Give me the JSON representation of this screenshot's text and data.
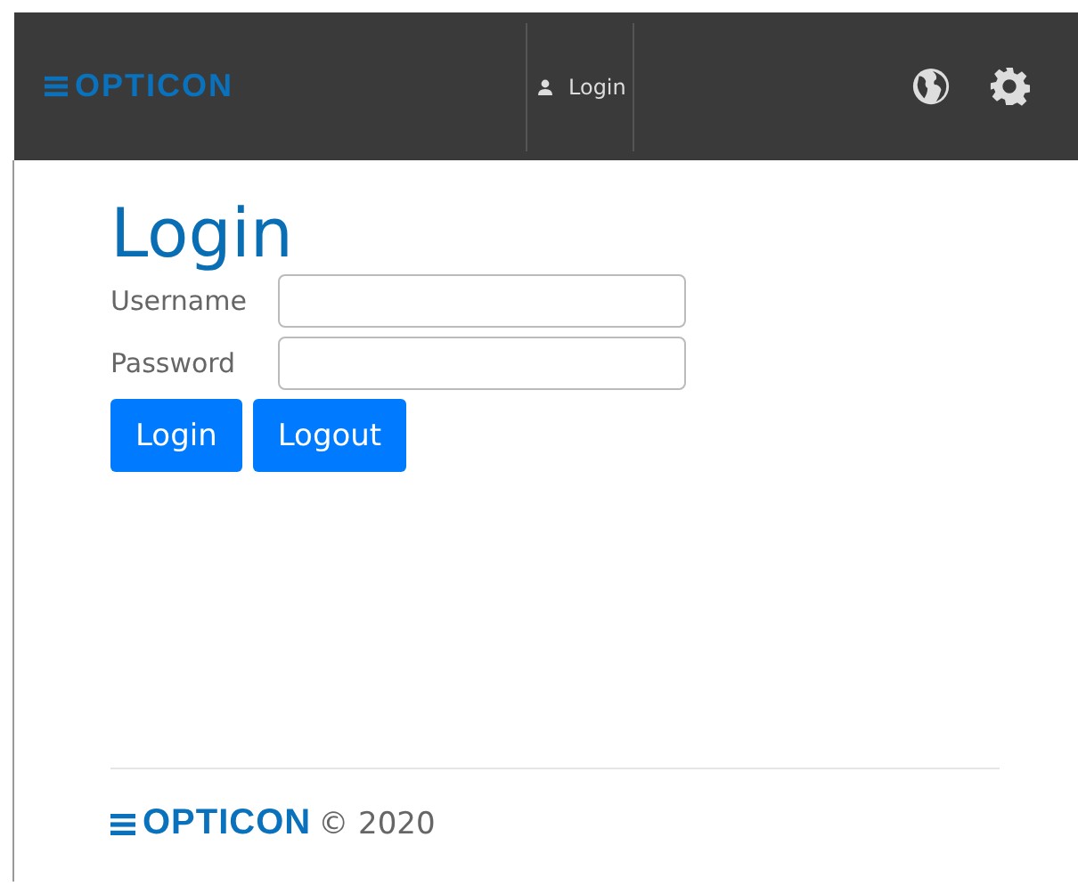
{
  "header": {
    "logo": "OPTICON",
    "nav": [
      {
        "label": "Login"
      }
    ]
  },
  "page": {
    "title": "Login",
    "fields": [
      {
        "label": "Username"
      },
      {
        "label": "Password"
      }
    ],
    "buttons": [
      "Login",
      "Logout"
    ]
  },
  "footer": {
    "logo": "OPTICON",
    "copyright": "© 2020"
  }
}
